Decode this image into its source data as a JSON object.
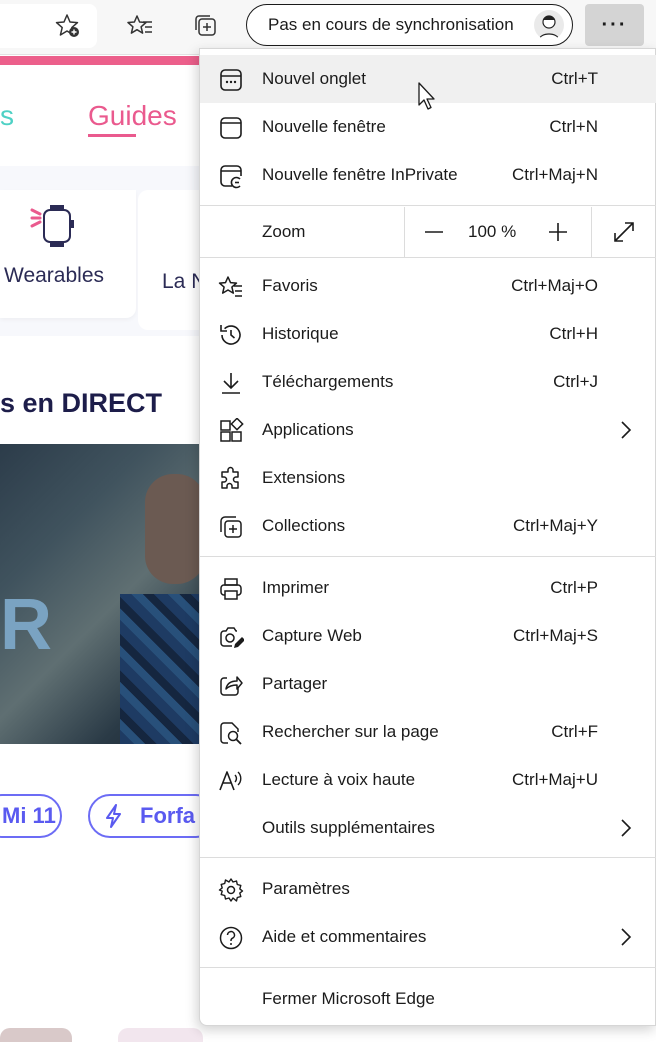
{
  "toolbar": {
    "sync_label": "Pas en cours de synchronisation",
    "more_label": "···"
  },
  "page": {
    "nav_partial": "s",
    "nav_guides": "Guides",
    "category_wearables": "Wearables",
    "category_partial": "La N",
    "heading_partial": "s en DIRECT",
    "photo_letter": "R",
    "pill_1": "Mi 11",
    "pill_2": "Forfa",
    "accent_pink": "#ea5a8e",
    "accent_blue": "#5a5af0"
  },
  "menu": {
    "items_top": [
      {
        "label": "Nouvel onglet",
        "shortcut": "Ctrl+T",
        "icon": "new-tab-icon"
      },
      {
        "label": "Nouvelle fenêtre",
        "shortcut": "Ctrl+N",
        "icon": "new-window-icon"
      },
      {
        "label": "Nouvelle fenêtre InPrivate",
        "shortcut": "Ctrl+Maj+N",
        "icon": "inprivate-window-icon"
      }
    ],
    "zoom": {
      "label": "Zoom",
      "value": "100 %",
      "minus": "—",
      "plus": "+"
    },
    "items_mid": [
      {
        "label": "Favoris",
        "shortcut": "Ctrl+Maj+O",
        "icon": "favorites-icon"
      },
      {
        "label": "Historique",
        "shortcut": "Ctrl+H",
        "icon": "history-icon"
      },
      {
        "label": "Téléchargements",
        "shortcut": "Ctrl+J",
        "icon": "download-icon"
      },
      {
        "label": "Applications",
        "shortcut": "",
        "icon": "apps-icon"
      },
      {
        "label": "Extensions",
        "shortcut": "",
        "icon": "extensions-icon"
      },
      {
        "label": "Collections",
        "shortcut": "Ctrl+Maj+Y",
        "icon": "collections-icon"
      }
    ],
    "items_tools": [
      {
        "label": "Imprimer",
        "shortcut": "Ctrl+P",
        "icon": "print-icon"
      },
      {
        "label": "Capture Web",
        "shortcut": "Ctrl+Maj+S",
        "icon": "web-capture-icon"
      },
      {
        "label": "Partager",
        "shortcut": "",
        "icon": "share-icon"
      },
      {
        "label": "Rechercher sur la page",
        "shortcut": "Ctrl+F",
        "icon": "find-icon"
      },
      {
        "label": "Lecture à voix haute",
        "shortcut": "Ctrl+Maj+U",
        "icon": "read-aloud-icon"
      },
      {
        "label": "Outils supplémentaires",
        "shortcut": "",
        "icon": ""
      }
    ],
    "items_settings": [
      {
        "label": "Paramètres",
        "shortcut": "",
        "icon": "settings-icon"
      },
      {
        "label": "Aide et commentaires",
        "shortcut": "",
        "icon": "help-icon"
      }
    ],
    "close_label": "Fermer Microsoft Edge"
  }
}
